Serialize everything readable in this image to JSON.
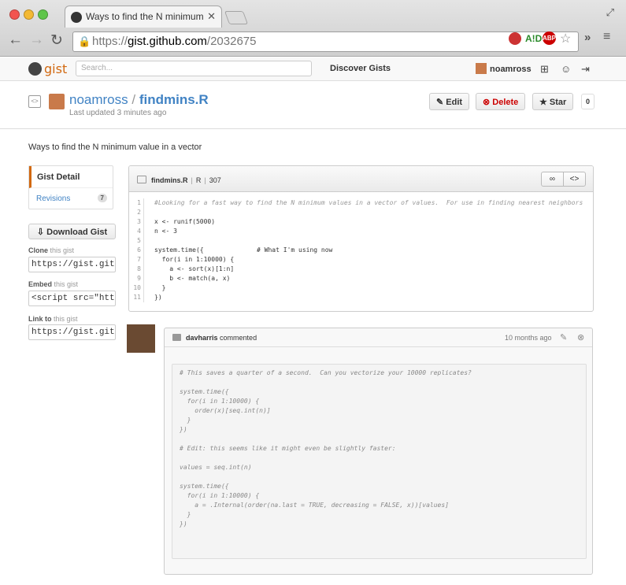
{
  "browser": {
    "tab_title": "Ways to find the N minimum",
    "url_scheme": "https://",
    "url_host": "gist.github.com",
    "url_path": "/2032675",
    "ext_labels": [
      "A!D",
      "ABP"
    ]
  },
  "gh_header": {
    "logo_text": "gist",
    "search_placeholder": "Search...",
    "discover": "Discover Gists",
    "username": "noamross"
  },
  "gist": {
    "owner": "noamross",
    "separator": "/",
    "filename": "findmins.R",
    "updated": "Last updated 3 minutes ago",
    "edit_label": "Edit",
    "delete_label": "Delete",
    "star_label": "Star",
    "star_count": "0",
    "description": "Ways to find the N minimum value in a vector"
  },
  "sidebar": {
    "detail_label": "Gist Detail",
    "revisions_label": "Revisions",
    "revisions_count": "7",
    "download_label": "Download Gist",
    "clone_label": "Clone",
    "clone_sub": "this gist",
    "clone_value": "https://gist.gith",
    "embed_label": "Embed",
    "embed_sub": "this gist",
    "embed_value": "<script src=\"http",
    "link_label": "Link to",
    "link_sub": "this gist",
    "link_value": "https://gist.gith"
  },
  "file": {
    "name": "findmins.R",
    "lang": "R",
    "size": "307",
    "lines": [
      {
        "n": "1",
        "t": "#Looking for a fast way to find the N minimum values in a vector of values.  For use in finding nearest neighbors"
      },
      {
        "n": "2",
        "t": ""
      },
      {
        "n": "3",
        "t": "x <- runif(5000)"
      },
      {
        "n": "4",
        "t": "n <- 3"
      },
      {
        "n": "5",
        "t": ""
      },
      {
        "n": "6",
        "t": "system.time({              # What I'm using now"
      },
      {
        "n": "7",
        "t": "  for(i in 1:10000) {"
      },
      {
        "n": "8",
        "t": "    a <- sort(x)[1:n]"
      },
      {
        "n": "9",
        "t": "    b <- match(a, x)"
      },
      {
        "n": "10",
        "t": "  }"
      },
      {
        "n": "11",
        "t": "})"
      }
    ]
  },
  "comment": {
    "author": "davharris",
    "action": "commented",
    "when": "10 months ago",
    "body": "# This saves a quarter of a second.  Can you vectorize your 10000 replicates?\n\nsystem.time({\n  for(i in 1:10000) {\n    order(x)[seq.int(n)]\n  }\n})\n\n# Edit: this seems like it might even be slightly faster:\n\nvalues = seq.int(n)\n\nsystem.time({\n  for(i in 1:10000) {\n    a = .Internal(order(na.last = TRUE, decreasing = FALSE, x))[values]\n  }\n})"
  }
}
